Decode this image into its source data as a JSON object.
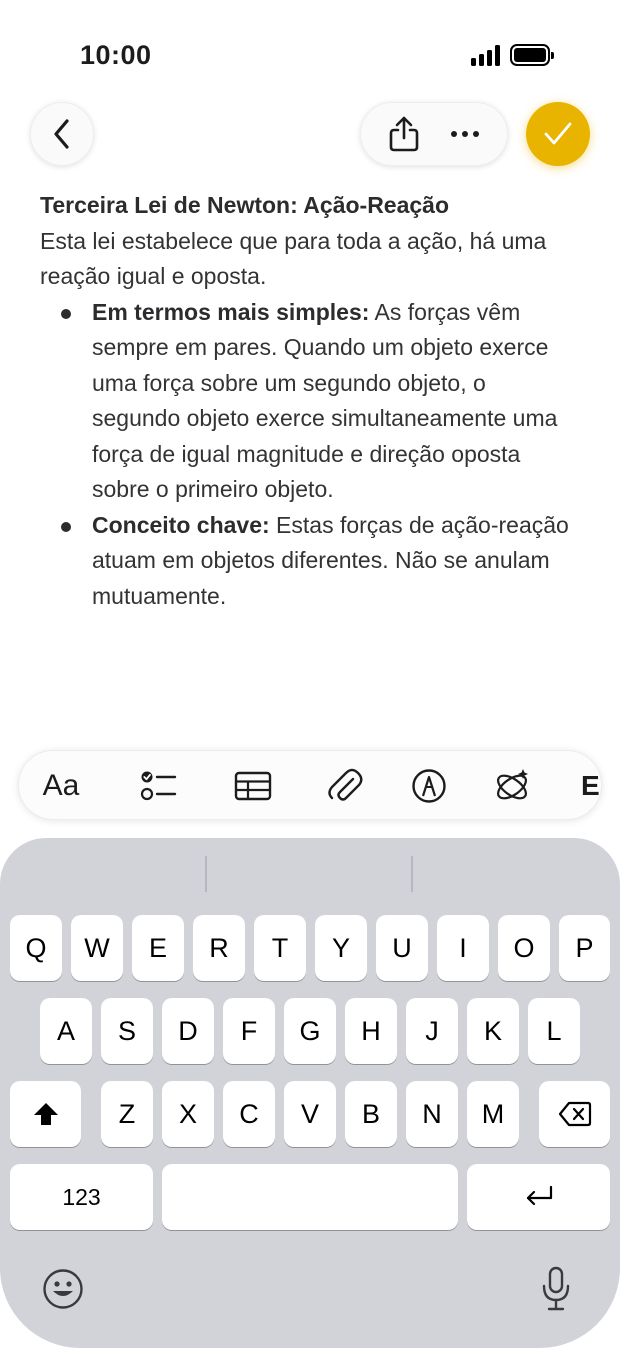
{
  "status_bar": {
    "time": "10:00"
  },
  "toolbar": {
    "back_icon": "chevron-left-icon",
    "share_icon": "share-icon",
    "more_icon": "ellipsis-icon",
    "done_icon": "checkmark-icon",
    "accent_color": "#e8b400"
  },
  "note": {
    "title": "Terceira Lei de Newton: Ação-Reação",
    "intro": "Esta lei estabelece que para toda a ação, há uma reação igual e oposta.",
    "bullets": [
      {
        "bold": "Em termos mais simples:",
        "text": " As forças vêm sempre em pares. Quando um objeto exerce uma força sobre um segundo objeto, o segundo objeto exerce simultaneamente uma força de igual magnitude e direção oposta sobre o primeiro objeto."
      },
      {
        "bold": "Conceito chave:",
        "text": " Estas forças de ação-reação atuam em objetos diferentes. Não se anulam mutuamente."
      }
    ]
  },
  "format_bar": {
    "text_style_label": "Aa",
    "icons": [
      "checklist-icon",
      "table-icon",
      "attachment-icon",
      "markup-icon",
      "writing-tools-icon"
    ],
    "overflow_label": "E"
  },
  "keyboard": {
    "row1": [
      "Q",
      "W",
      "E",
      "R",
      "T",
      "Y",
      "U",
      "I",
      "O",
      "P"
    ],
    "row2": [
      "A",
      "S",
      "D",
      "F",
      "G",
      "H",
      "J",
      "K",
      "L"
    ],
    "row3": [
      "Z",
      "X",
      "C",
      "V",
      "B",
      "N",
      "M"
    ],
    "numbers_label": "123",
    "shift_icon": "shift-icon",
    "delete_icon": "delete-icon",
    "return_icon": "return-icon",
    "emoji_icon": "emoji-icon",
    "mic_icon": "microphone-icon",
    "background_color": "#d1d3d9"
  }
}
